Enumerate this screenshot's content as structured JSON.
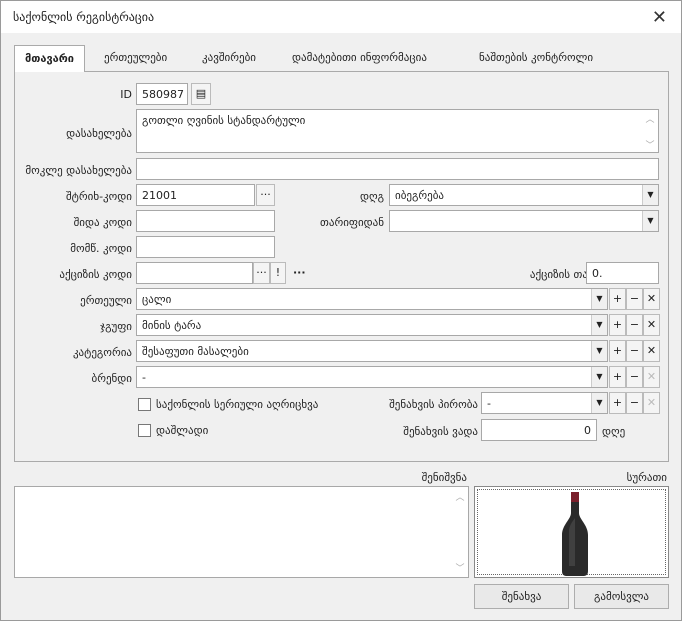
{
  "window": {
    "title": "საქონლის რეგისტრაცია"
  },
  "tabs": [
    "მთავარი",
    "ერთეულები",
    "კავშირები",
    "დამატებითი ინფორმაცია",
    "ნაშთების კონტროლი"
  ],
  "form": {
    "id_label": "ID",
    "id_value": "580987",
    "name_label": "დასახელება",
    "name_value": "გოთლი ღვინის სტანდარტული",
    "shortname_label": "მოკლე დასახელება",
    "shortname_value": "",
    "barcode_label": "შტრიხ-კოდი",
    "barcode_value": "21001",
    "vat_label": "დღგ",
    "vat_value": "იბეგრება",
    "internal_code_label": "შიდა კოდი",
    "internal_code_value": "",
    "tariff_label": "თარიფიდან",
    "tariff_value": "",
    "supplier_code_label": "მომწ. კოდი",
    "supplier_code_value": "",
    "promo_code_label": "აქციზის კოდი",
    "promo_code_value": "",
    "promo_amount_label": "აქციზის თანხა",
    "promo_amount_value": "0.",
    "unit_label": "ერთეული",
    "unit_value": "ცალი",
    "group_label": "ჯგუფი",
    "group_value": "მინის ტარა",
    "category_label": "კატეგორია",
    "category_value": "შესაფუთი მასალები",
    "brand_label": "ბრენდი",
    "brand_value": "-",
    "serial_label": "საქონლის სერიული აღრიცხვა",
    "storage_cond_label": "შენახვის პირობა",
    "storage_cond_value": "-",
    "discount_label": "დაშლადი",
    "storage_term_label": "შენახვის ვადა",
    "storage_term_value": "0",
    "days_label": "დღე"
  },
  "notes_label": "შენიშვნა",
  "photo_label": "სურათი",
  "buttons": {
    "save": "შენახვა",
    "cancel": "გამოსვლა"
  }
}
